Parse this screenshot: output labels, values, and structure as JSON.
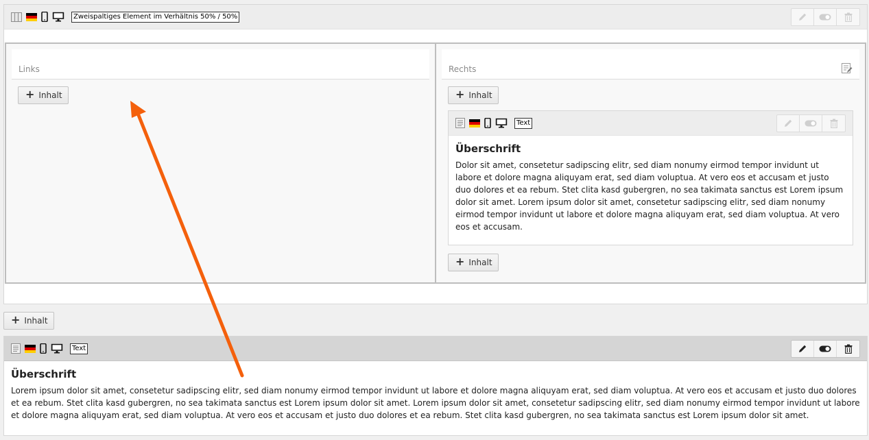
{
  "container": {
    "type_label": "Zweispaltiges Element im Verhältnis 50% / 50%"
  },
  "columns": {
    "left_label": "Links",
    "right_label": "Rechts"
  },
  "buttons": {
    "add_content": "Inhalt"
  },
  "inner_text_element": {
    "type_label": "Text",
    "heading": "Überschrift",
    "body": "Dolor sit amet, consetetur sadipscing elitr, sed diam nonumy eirmod tempor invidunt ut labore et dolore magna aliquyam erat, sed diam voluptua. At vero eos et accusam et justo duo dolores et ea rebum. Stet clita kasd gubergren, no sea takimata sanctus est Lorem ipsum dolor sit amet. Lorem ipsum dolor sit amet, consetetur sadipscing elitr, sed diam nonumy eirmod tempor invidunt ut labore et dolore magna aliquyam erat, sed diam voluptua. At vero eos et accusam."
  },
  "outer_text_element": {
    "type_label": "Text",
    "heading": "Überschrift",
    "body": "Lorem ipsum dolor sit amet, consetetur sadipscing elitr, sed diam nonumy eirmod tempor invidunt ut labore et dolore magna aliquyam erat, sed diam voluptua. At vero eos et accusam et justo duo dolores et ea rebum. Stet clita kasd gubergren, no sea takimata sanctus est Lorem ipsum dolor sit amet. Lorem ipsum dolor sit amet, consetetur sadipscing elitr, sed diam nonumy eirmod tempor invidunt ut labore et dolore magna aliquyam erat, sed diam voluptua. At vero eos et accusam et justo duo dolores et ea rebum. Stet clita kasd gubergren, no sea takimata sanctus est Lorem ipsum dolor sit amet."
  },
  "icons": {
    "grid": "two-column-grid-icon",
    "language": "german-flag-icon",
    "mobile": "mobile-device-icon",
    "desktop": "desktop-device-icon",
    "text": "text-element-icon",
    "edit": "pencil-icon",
    "toggle": "toggle-icon",
    "delete": "trash-icon",
    "column_edit": "column-edit-icon"
  },
  "annotation": {
    "arrow_color": "#f4600c"
  }
}
